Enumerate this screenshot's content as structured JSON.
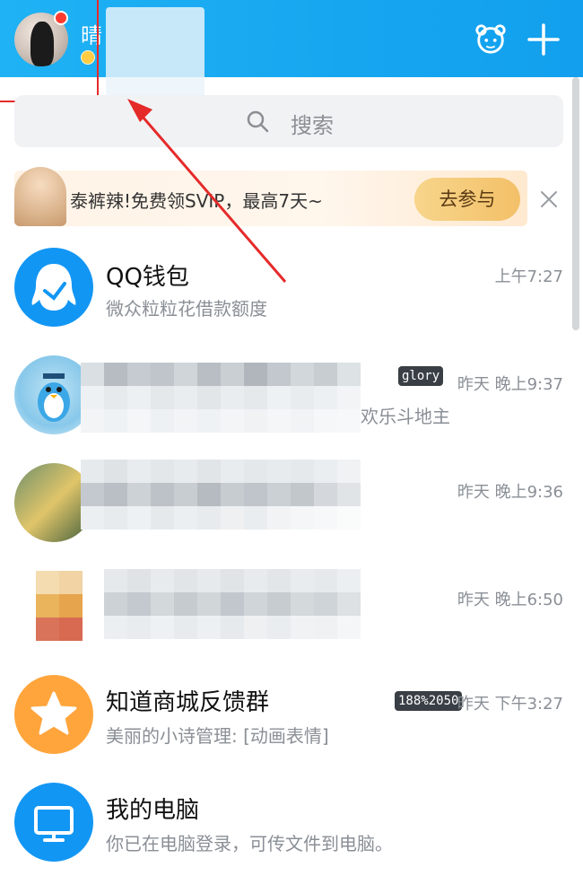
{
  "header": {
    "nickname": "晴",
    "icons": {
      "pet": "pet-icon",
      "add": "plus-icon"
    }
  },
  "search": {
    "placeholder": "搜索",
    "icon": "search-icon"
  },
  "promo": {
    "text": "泰裤辣!免费领SVIP，最高7天~",
    "button_label": "去参与",
    "close_icon": "close-icon"
  },
  "chats": [
    {
      "title": "QQ钱包",
      "subtitle": "微众粒粒花借款额度",
      "time": "上午7:27",
      "badge": "",
      "avatar": "qq-wallet-icon"
    },
    {
      "title": "",
      "subtitle": "欢乐斗地主",
      "time": "昨天 晚上9:37",
      "badge": "glory",
      "avatar": "penguin-avatar"
    },
    {
      "title": "",
      "subtitle": "",
      "time": "昨天 晚上9:36",
      "badge": "",
      "avatar": "group-avatar"
    },
    {
      "title": "",
      "subtitle": "",
      "time": "昨天 晚上6:50",
      "badge": "",
      "avatar": "blurred-avatar"
    },
    {
      "title": "知道商城反馈群",
      "subtitle": "美丽的小诗管理: [动画表情]",
      "time": "昨天 下午3:27",
      "badge": "188%2050",
      "avatar": "star-icon"
    },
    {
      "title": "我的电脑",
      "subtitle": "你已在电脑登录，可传文件到电脑。",
      "time": "",
      "badge": "",
      "avatar": "computer-icon"
    }
  ],
  "colors": {
    "header_blue": "#16a6f0",
    "annotation_red": "#e52a2a",
    "wallet_blue": "#1296f4",
    "star_orange": "#ffa53c",
    "pc_blue": "#1296f4"
  }
}
